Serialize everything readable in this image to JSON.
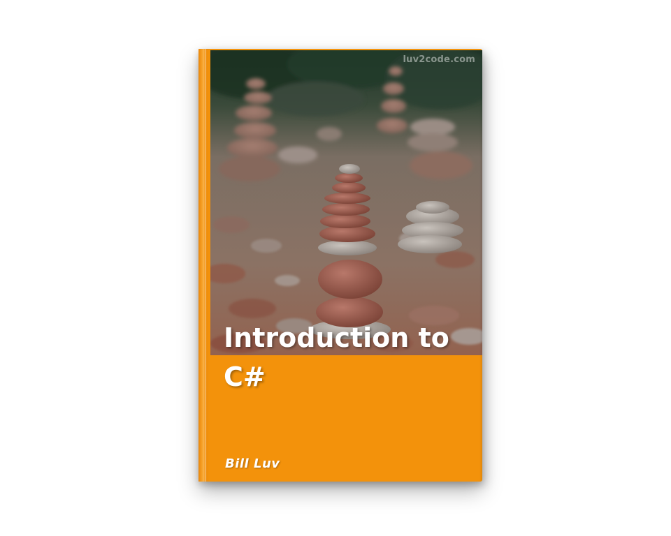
{
  "book": {
    "publisher": "luv2code.com",
    "title": "Introduction to C#",
    "author": "Bill Luv"
  },
  "colors": {
    "cover": "#f3920b",
    "text": "#ffffff",
    "background": "#ffffff"
  },
  "image": {
    "subject": "stacked-stone-cairns-photo"
  }
}
